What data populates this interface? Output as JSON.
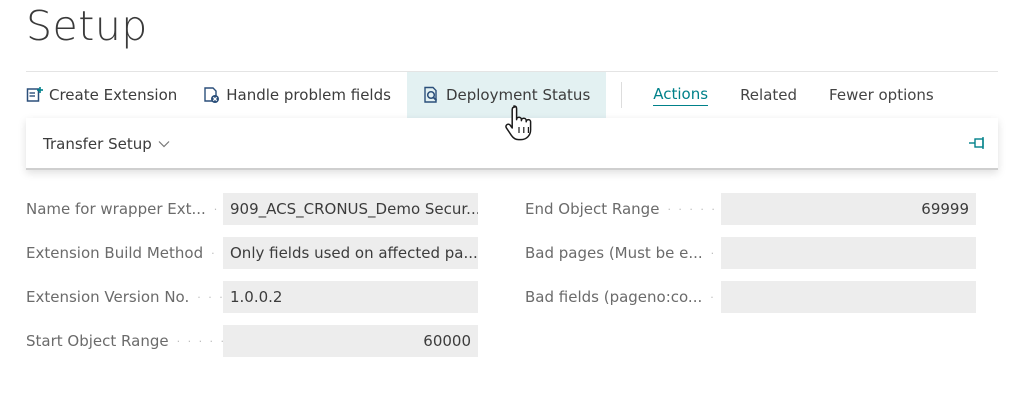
{
  "page": {
    "title": "Setup"
  },
  "actions": {
    "create_extension": "Create Extension",
    "handle_problem_fields": "Handle problem fields",
    "deployment_status": "Deployment Status"
  },
  "menus": {
    "actions": "Actions",
    "related": "Related",
    "fewer_options": "Fewer options"
  },
  "flyout": {
    "label": "Transfer Setup"
  },
  "fields_left": [
    {
      "label": "Name for wrapper Ext...",
      "value": "909_ACS_CRONUS_Demo Secur..."
    },
    {
      "label": "Extension Build Method",
      "value": "Only fields used on affected pa..."
    },
    {
      "label": "Extension Version No.",
      "value": "1.0.0.2"
    },
    {
      "label": "Start Object Range",
      "value": "60000"
    }
  ],
  "fields_right": [
    {
      "label": "End Object Range",
      "value": "69999"
    },
    {
      "label": "Bad pages (Must be e...",
      "value": ""
    },
    {
      "label": "Bad fields (pageno:co...",
      "value": ""
    }
  ],
  "colors": {
    "accent": "#00818a",
    "hover_bg": "#e3f1f2",
    "field_bg": "#ededed"
  }
}
